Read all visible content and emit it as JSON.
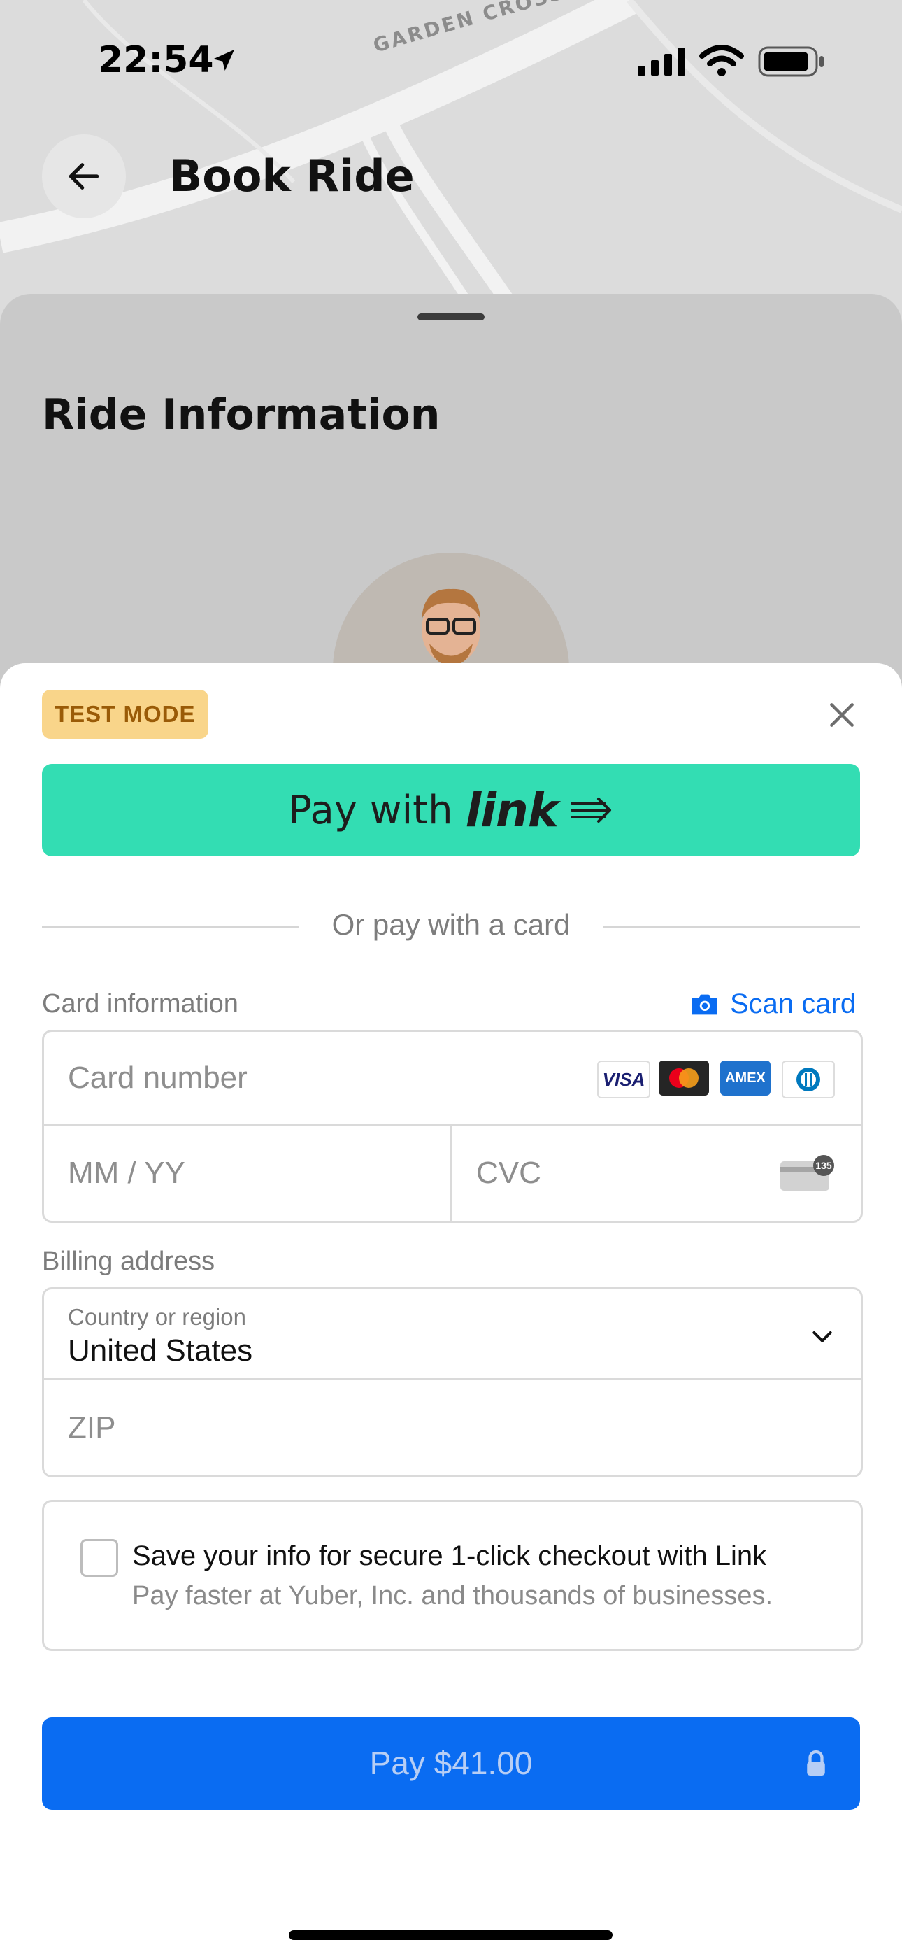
{
  "status_bar": {
    "time": "22:54"
  },
  "map": {
    "road_label": "GARDEN CROSS ROAD"
  },
  "header": {
    "title": "Book Ride"
  },
  "ride": {
    "section_title": "Ride Information"
  },
  "payment_sheet": {
    "badge": "TEST MODE",
    "link_button": {
      "prefix": "Pay with",
      "brand": "link"
    },
    "divider_text": "Or pay with a card",
    "card_info_label": "Card information",
    "scan_card_label": "Scan card",
    "card_number_placeholder": "Card number",
    "expiry_placeholder": "MM / YY",
    "cvc_placeholder": "CVC",
    "cvc_hint": "135",
    "card_brands": [
      "VISA",
      "Mastercard",
      "AMEX",
      "Diners"
    ],
    "billing_label": "Billing address",
    "country_label": "Country or region",
    "country_value": "United States",
    "zip_placeholder": "ZIP",
    "save_info": {
      "title": "Save your info for secure 1-click checkout with Link",
      "subtitle": "Pay faster at Yuber, Inc. and thousands of businesses.",
      "checked": false
    },
    "pay_button_label": "Pay $41.00"
  },
  "colors": {
    "link_green": "#33ddb3",
    "primary_blue": "#0a6cf2",
    "test_badge_bg": "#f9d58a",
    "test_badge_text": "#9a5b07"
  }
}
